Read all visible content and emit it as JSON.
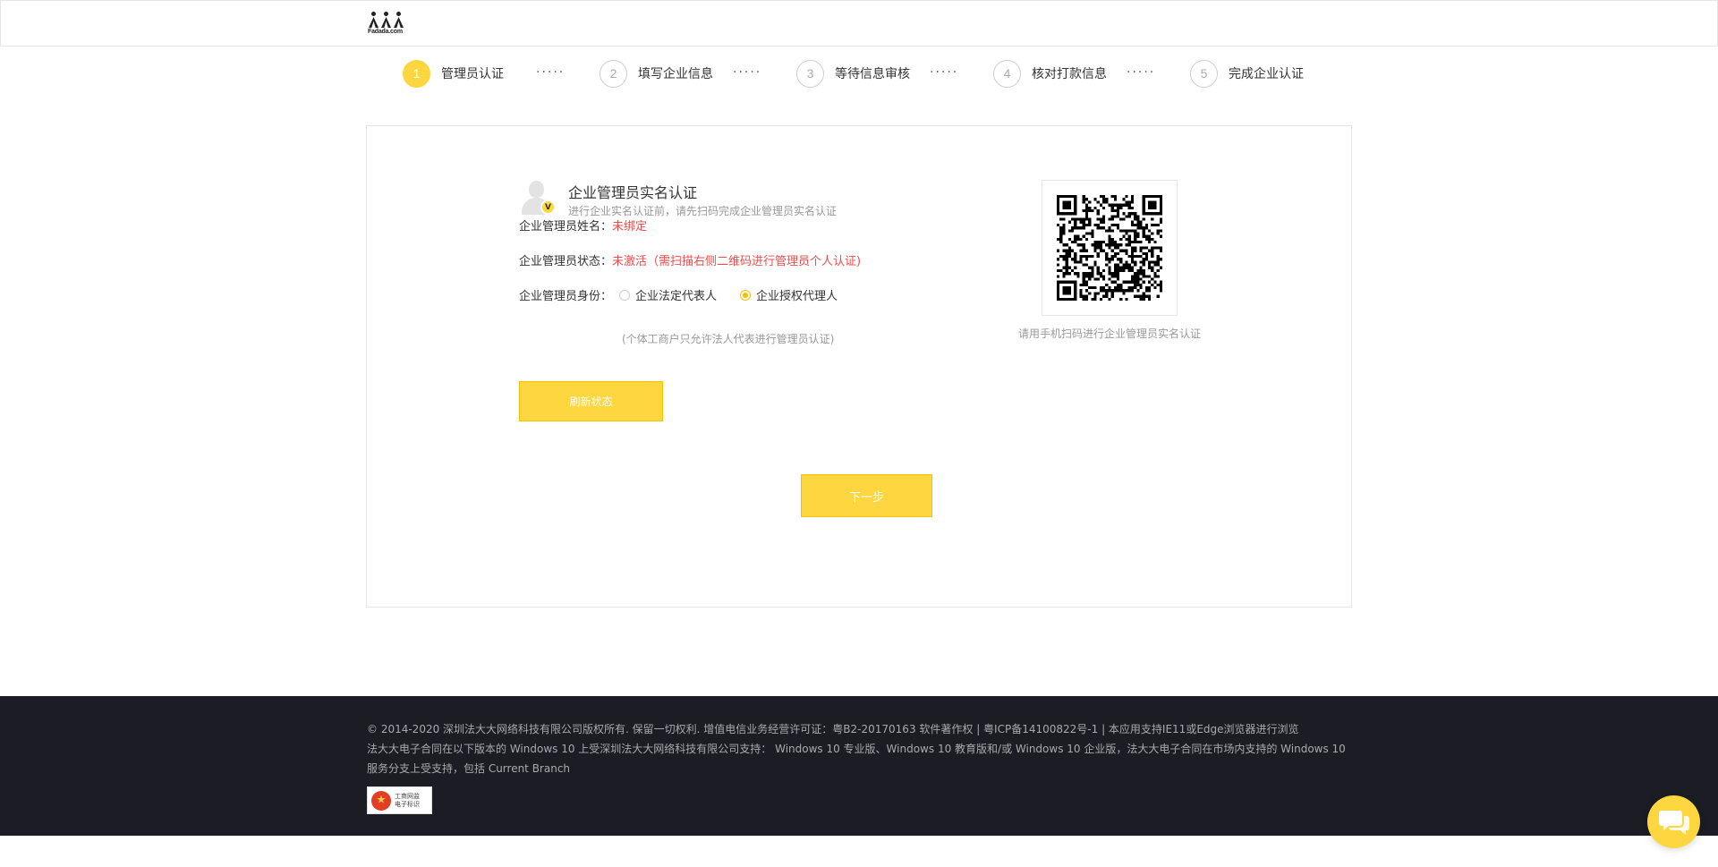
{
  "header": {
    "logo_text": "Fadada.com"
  },
  "steps": [
    {
      "number": "1",
      "label": "管理员认证",
      "active": true
    },
    {
      "number": "2",
      "label": "填写企业信息",
      "active": false
    },
    {
      "number": "3",
      "label": "等待信息审核",
      "active": false
    },
    {
      "number": "4",
      "label": "核对打款信息",
      "active": false
    },
    {
      "number": "5",
      "label": "完成企业认证",
      "active": false
    }
  ],
  "step_separator": "·····",
  "admin": {
    "title": "企业管理员实名认证",
    "subtitle": "进行企业实名认证前，请先扫码完成企业管理员实名认证",
    "name_label": "企业管理员姓名：",
    "name_value": "未绑定",
    "status_label": "企业管理员状态：",
    "status_value": "未激活（需扫描右侧二维码进行管理员个人认证)",
    "identity_label": "企业管理员身份：",
    "identity_options": [
      {
        "label": "企业法定代表人",
        "checked": false
      },
      {
        "label": "企业授权代理人",
        "checked": true
      }
    ],
    "identity_hint": "(个体工商户只允许法人代表进行管理员认证)",
    "refresh_label": "刷新状态",
    "badge_letter": "V"
  },
  "qr": {
    "caption": "请用手机扫码进行企业管理员实名认证"
  },
  "next_label": "下一步",
  "footer": {
    "line1": "© 2014-2020 深圳法大大网络科技有限公司版权所有. 保留一切权利. 增值电信业务经营许可证：粤B2-20170163 软件著作权  |  粤ICP备14100822号-1 |  本应用支持IE11或Edge浏览器进行浏览",
    "line2": "法大大电子合同在以下版本的 Windows 10 上受深圳法大大网络科技有限公司支持： Windows 10 专业版、Windows 10 教育版和/或 Windows 10 企业版，法大大电子合同在市场内支持的 Windows 10 服务分支上受支持，包括 Current Branch",
    "badge_line1": "工商网监",
    "badge_line2": "电子标识"
  },
  "colors": {
    "accent": "#fdd640",
    "error": "#f24b4b",
    "footer_bg": "#1c1d24"
  }
}
